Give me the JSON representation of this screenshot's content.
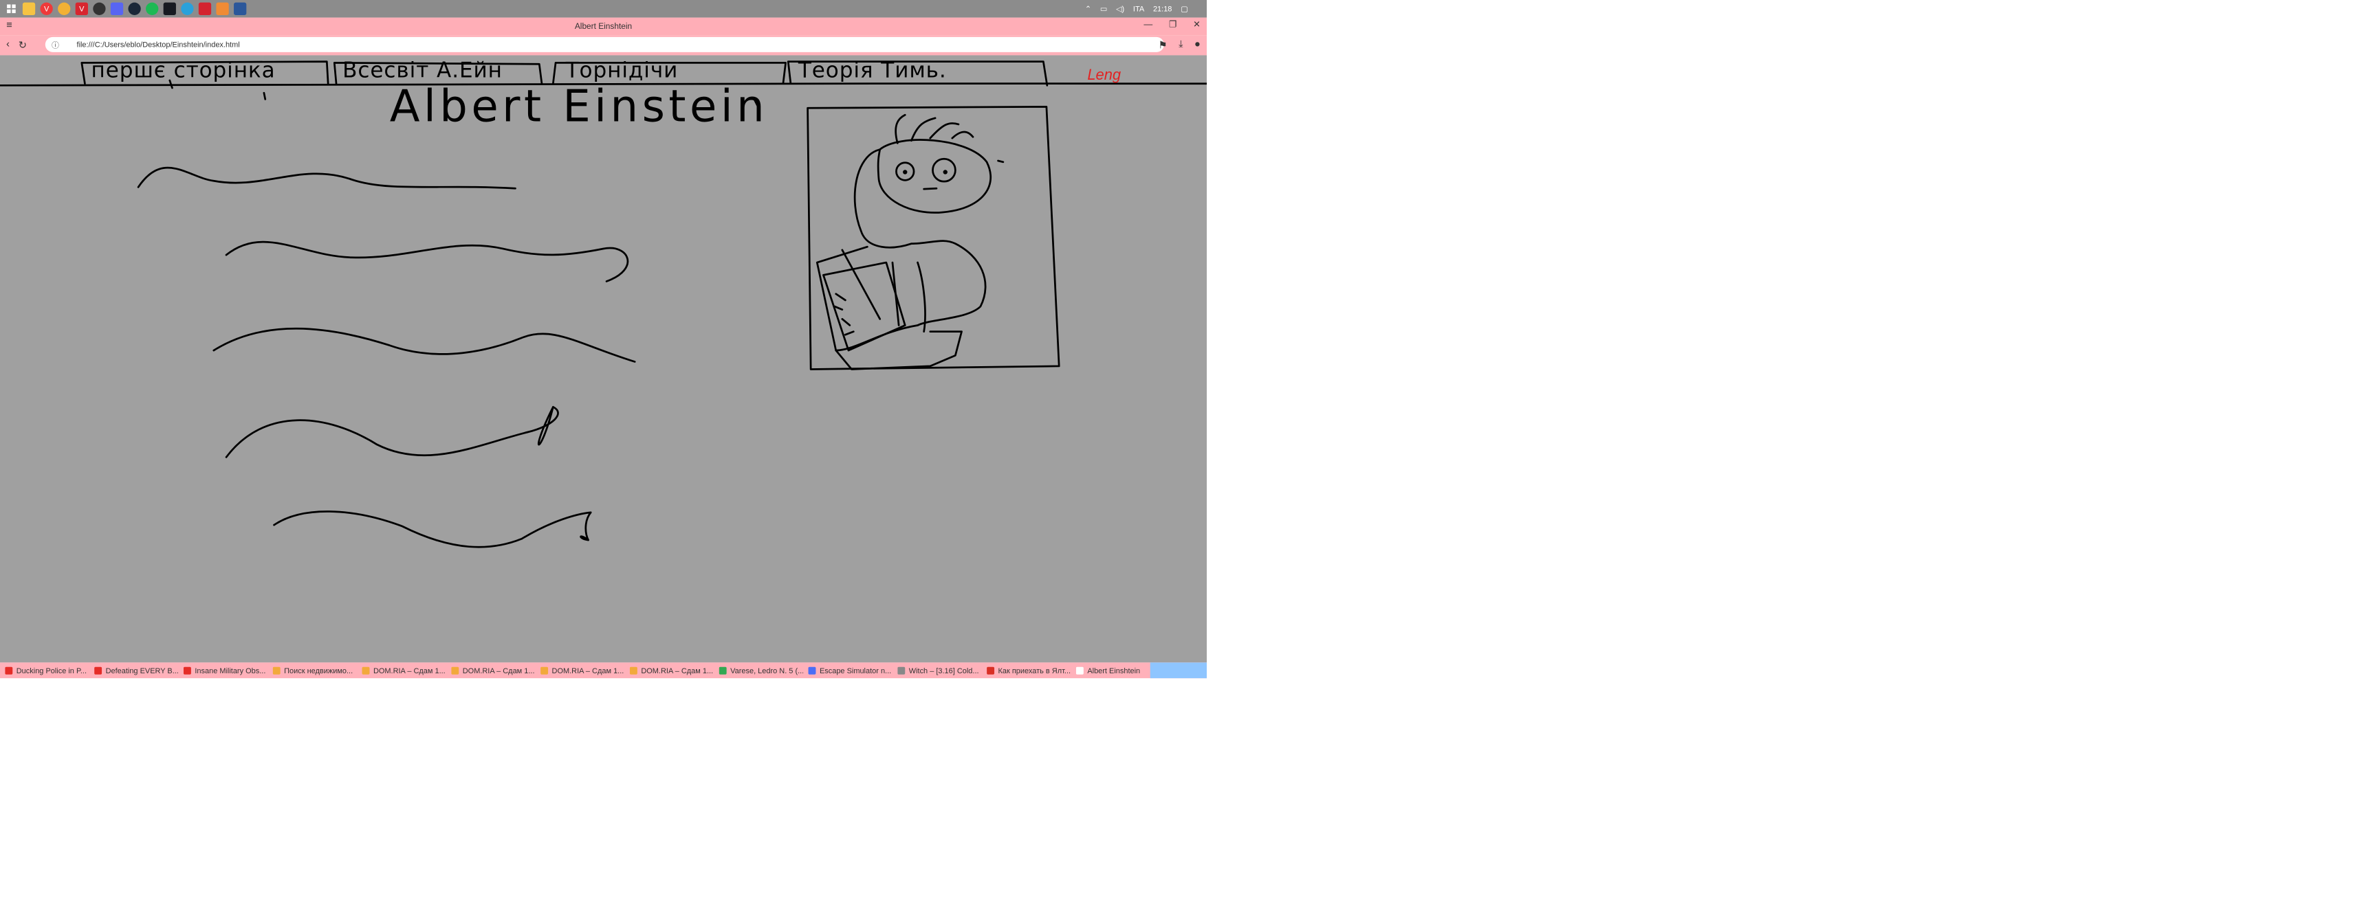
{
  "os_taskbar": {
    "icons": [
      "windows-start-icon",
      "folder-icon",
      "vivaldi-icon",
      "chrome-icon",
      "vivaldi-red-icon",
      "obs-icon",
      "discord-icon",
      "steam-icon",
      "spotify-icon",
      "steam-alt-icon",
      "telegram-icon",
      "acrobat-icon",
      "sublime-icon",
      "word-icon"
    ],
    "tray": {
      "language": "ITA",
      "time": "21:18"
    }
  },
  "window": {
    "title": "Albert Einshtein"
  },
  "address_bar": {
    "url": "file:///C:/Users/eblo/Desktop/Einshtein/index.html"
  },
  "page": {
    "nav": [
      {
        "label": "першє сторінка"
      },
      {
        "label": "Всесвіт А.Ейн"
      },
      {
        "label": "Торнідічи"
      },
      {
        "label": "Теорія Тимь."
      }
    ],
    "lang_link": "Leng",
    "heading": "Albert Einstein"
  },
  "bookmarks": [
    {
      "label": "Ducking Police in P...",
      "color": "#e52d27"
    },
    {
      "label": "Defeating EVERY B...",
      "color": "#e52d27"
    },
    {
      "label": "Insane Military Obs...",
      "color": "#e52d27"
    },
    {
      "label": "Поиск недвижимо...",
      "color": "#f2a93b"
    },
    {
      "label": "DOM.RIA – Сдам 1...",
      "color": "#f2a93b"
    },
    {
      "label": "DOM.RIA – Сдам 1...",
      "color": "#f2a93b"
    },
    {
      "label": "DOM.RIA – Сдам 1...",
      "color": "#f2a93b"
    },
    {
      "label": "DOM.RIA – Сдам 1...",
      "color": "#f2a93b"
    },
    {
      "label": "Varese, Ledro N. 5 (...",
      "color": "#34a853"
    },
    {
      "label": "Escape Simulator n...",
      "color": "#4c6ef5"
    },
    {
      "label": "Witch – [3.16] Cold...",
      "color": "#888888"
    },
    {
      "label": "Как приехать в Ялт...",
      "color": "#d93025"
    },
    {
      "label": "Albert Einshtein",
      "color": "#ffffff"
    }
  ],
  "colors": {
    "taskbar": "#8c8c8c",
    "browser_chrome": "#ffb1ba",
    "page_bg": "#a0a0a0",
    "lang_link": "#e32222"
  }
}
